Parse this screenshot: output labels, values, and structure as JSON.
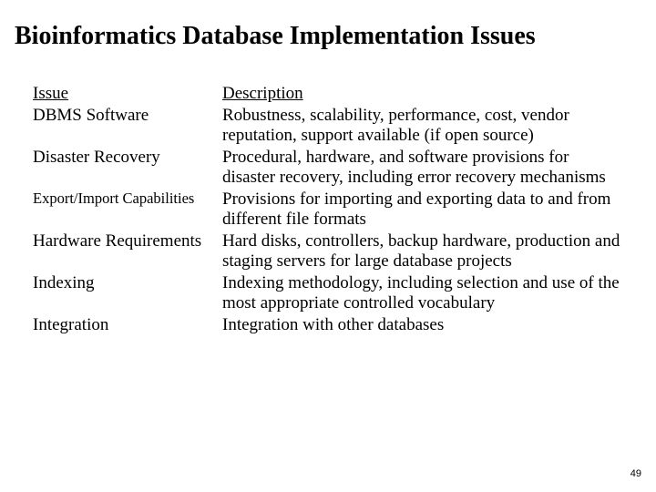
{
  "title": "Bioinformatics Database Implementation Issues",
  "headers": {
    "issue": "Issue",
    "description": "Description"
  },
  "rows": [
    {
      "issue": "DBMS Software",
      "description": "Robustness, scalability, performance, cost, vendor reputation, support available (if  open source)",
      "small": false
    },
    {
      "issue": "Disaster Recovery",
      "description": "Procedural, hardware, and software provisions for disaster recovery, including error recovery mechanisms",
      "small": false
    },
    {
      "issue": "Export/Import Capabilities",
      "description": "Provisions for importing and exporting data to and from different file formats",
      "small": true
    },
    {
      "issue": "Hardware Requirements",
      "description": "Hard disks, controllers, backup hardware, production and staging servers for large database projects",
      "small": false
    },
    {
      "issue": "Indexing",
      "description": "Indexing methodology, including selection and use of the most appropriate controlled vocabulary",
      "small": false
    },
    {
      "issue": "Integration",
      "description": "Integration with other databases",
      "small": false
    }
  ],
  "page_number": "49"
}
